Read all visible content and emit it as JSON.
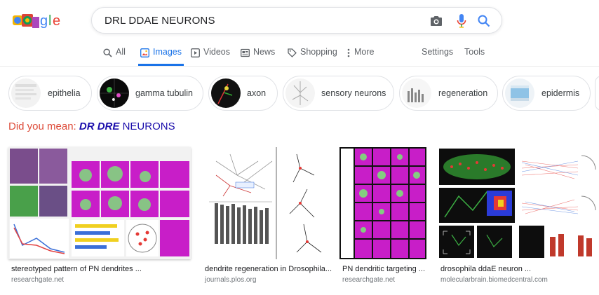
{
  "search": {
    "query": "DRL DDAE NEURONS"
  },
  "tabs": [
    {
      "label": "All",
      "icon": "search-icon"
    },
    {
      "label": "Images",
      "icon": "image-icon",
      "active": true
    },
    {
      "label": "Videos",
      "icon": "video-icon"
    },
    {
      "label": "News",
      "icon": "news-icon"
    },
    {
      "label": "Shopping",
      "icon": "tag-icon"
    },
    {
      "label": "More",
      "icon": "more-vert-icon"
    }
  ],
  "tools": {
    "settings": "Settings",
    "tools": "Tools"
  },
  "chips": [
    {
      "label": "epithelia"
    },
    {
      "label": "gamma tubulin"
    },
    {
      "label": "axon"
    },
    {
      "label": "sensory neurons"
    },
    {
      "label": "regeneration"
    },
    {
      "label": "epidermis"
    }
  ],
  "did_you_mean": {
    "prefix": "Did you mean:",
    "corrected": "DR DRE",
    "rest": "NEURONS"
  },
  "results": [
    {
      "title": "stereotyped pattern of PN dendrites ...",
      "source": "researchgate.net"
    },
    {
      "title": "dendrite regeneration in Drosophila...",
      "source": "journals.plos.org"
    },
    {
      "title": "PN dendritic targeting ...",
      "source": "researchgate.net"
    },
    {
      "title": "drosophila ddaE neuron ...",
      "source": "molecularbrain.biomedcentral.com"
    }
  ],
  "colors": {
    "accent": "#1a73e8",
    "link": "#1a0dab",
    "did_you_mean": "#dd4b39",
    "magenta": "#c81ec8"
  }
}
